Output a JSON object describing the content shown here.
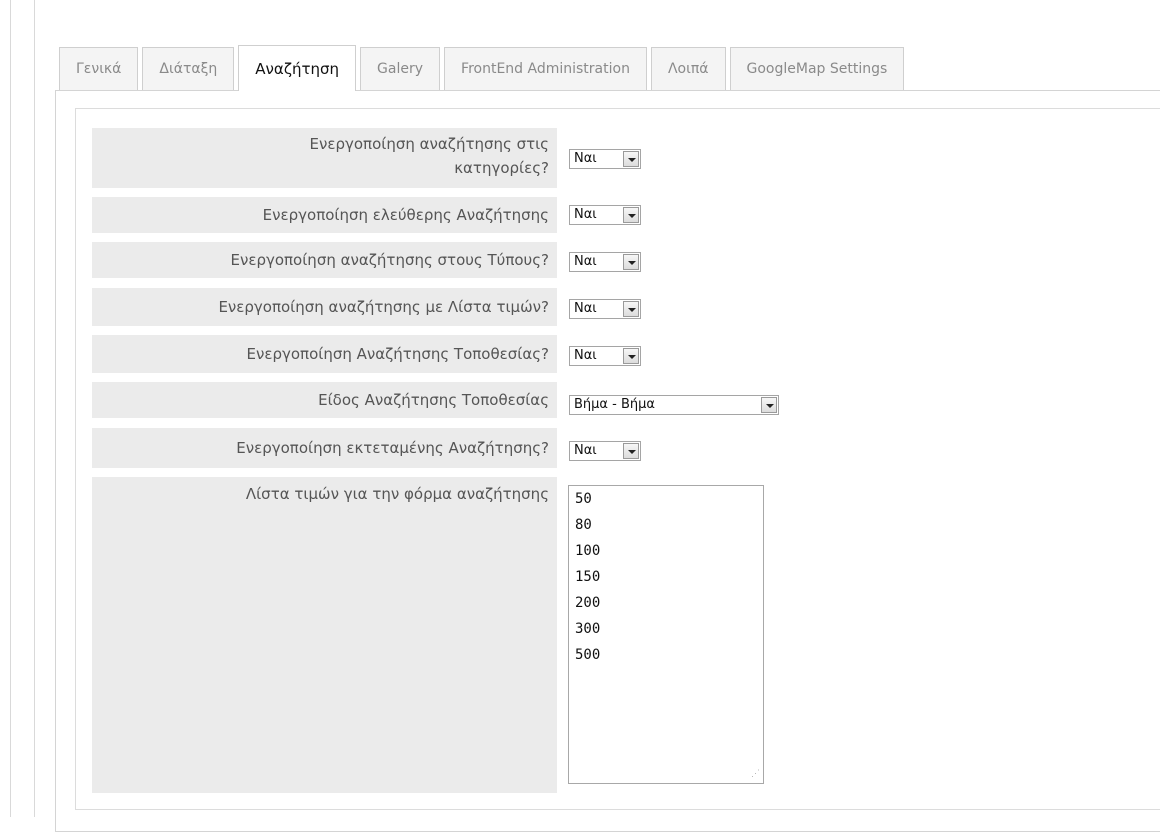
{
  "tabs": [
    {
      "label": "Γενικά",
      "active": false
    },
    {
      "label": "Διάταξη",
      "active": false
    },
    {
      "label": "Αναζήτηση",
      "active": true
    },
    {
      "label": "Galery",
      "active": false
    },
    {
      "label": "FrontEnd Administration",
      "active": false
    },
    {
      "label": "Λοιπά",
      "active": false
    },
    {
      "label": "GoogleMap Settings",
      "active": false
    }
  ],
  "form": {
    "rows": [
      {
        "label_line1": "Ενεργοποίηση αναζήτησης στις",
        "label_line2": "κατηγορίες?",
        "value": "Ναι"
      },
      {
        "label": "Ενεργοποίηση ελεύθερης Αναζήτησης",
        "value": "Ναι"
      },
      {
        "label": "Ενεργοποίηση αναζήτησης στους Τύπους?",
        "value": "Ναι"
      },
      {
        "label": "Ενεργοποίηση αναζήτησης με Λίστα τιμών?",
        "value": "Ναι"
      },
      {
        "label": "Ενεργοποίηση Αναζήτησης Τοποθεσίας?",
        "value": "Ναι"
      },
      {
        "label": "Είδος Αναζήτησης Τοποθεσίας",
        "value": "Βήμα - Βήμα"
      },
      {
        "label": "Ενεργοποίηση εκτεταμένης Αναζήτησης?",
        "value": "Ναι"
      },
      {
        "label": "Λίστα τιμών για την φόρμα αναζήτησης",
        "values": [
          "50",
          "80",
          "100",
          "150",
          "200",
          "300",
          "500"
        ]
      }
    ]
  },
  "icons": {
    "dropdown": "chevron-down-icon",
    "resize": "resize-grip-icon"
  },
  "colors": {
    "label_bg": "#ebebeb",
    "label_text": "#555555",
    "border": "#d4d4d4"
  }
}
